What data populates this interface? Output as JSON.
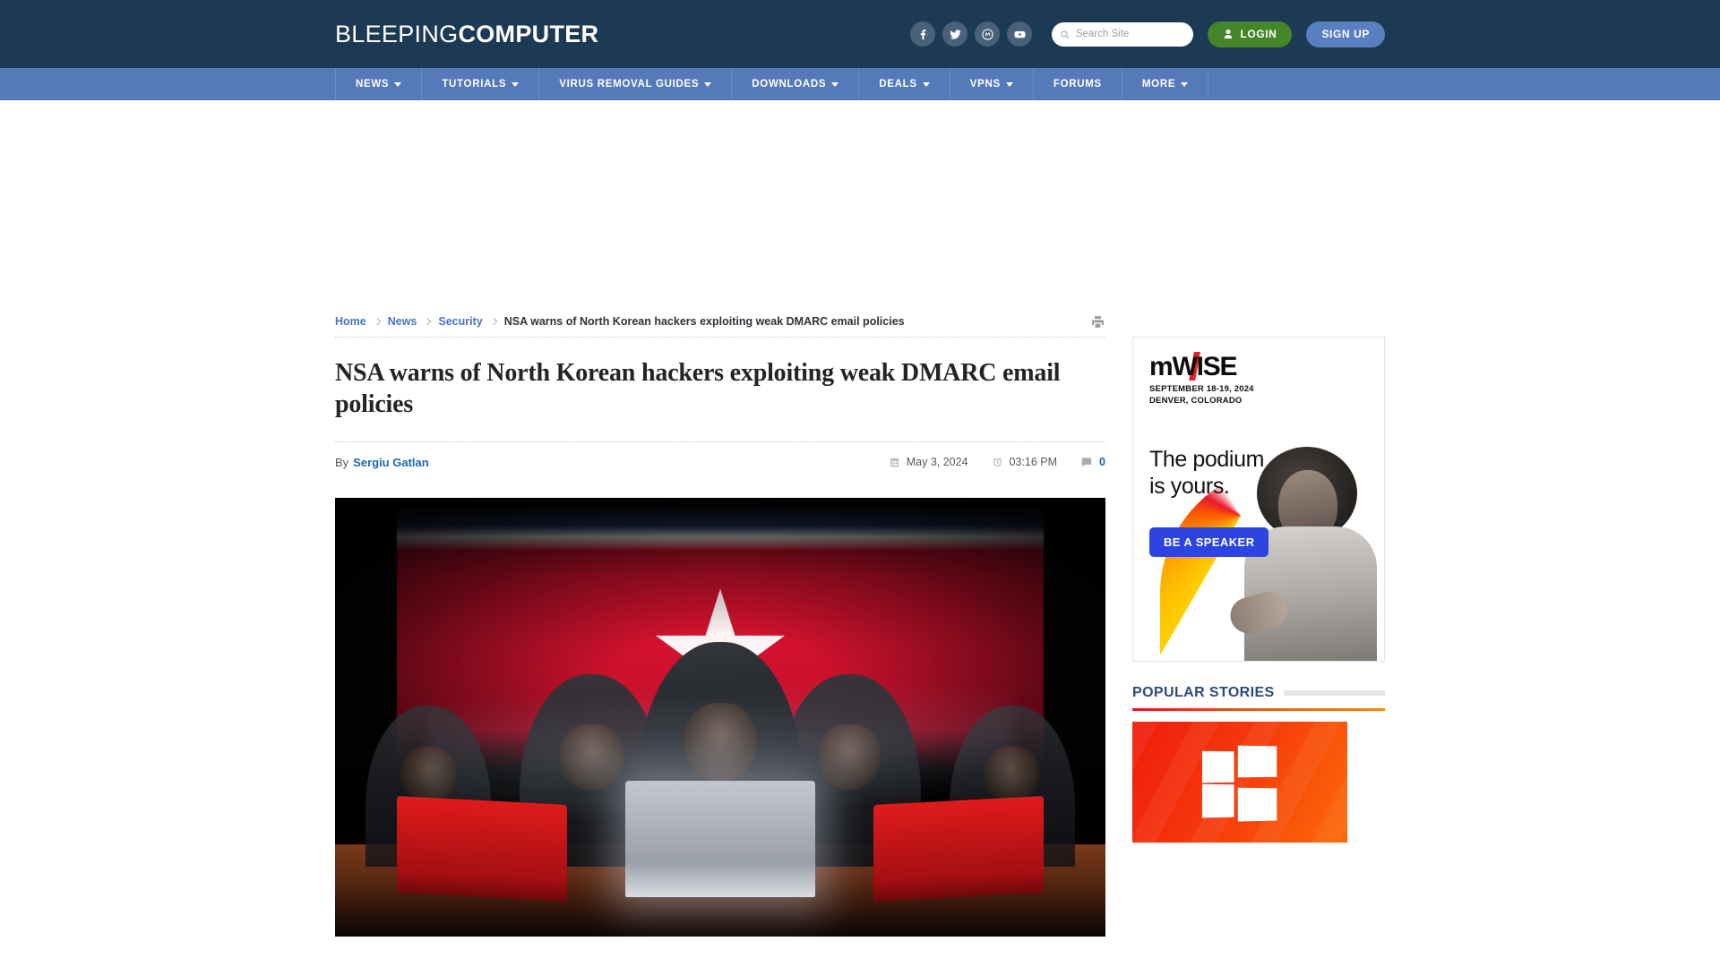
{
  "header": {
    "logo_light": "BLEEPING",
    "logo_bold": "COMPUTER",
    "social": [
      {
        "name": "facebook-icon",
        "label": "Facebook"
      },
      {
        "name": "twitter-icon",
        "label": "Twitter"
      },
      {
        "name": "mastodon-icon",
        "label": "Mastodon"
      },
      {
        "name": "youtube-icon",
        "label": "YouTube"
      }
    ],
    "search_placeholder": "Search Site",
    "search_value": "",
    "login_label": "LOGIN",
    "signup_label": "SIGN UP",
    "bg_color": "#1d3a55",
    "login_color": "#46862a",
    "signup_color": "#5a7fc0"
  },
  "nav": {
    "bg_color": "#5579b9",
    "items": [
      {
        "label": "NEWS",
        "has_dropdown": true
      },
      {
        "label": "TUTORIALS",
        "has_dropdown": true
      },
      {
        "label": "VIRUS REMOVAL GUIDES",
        "has_dropdown": true
      },
      {
        "label": "DOWNLOADS",
        "has_dropdown": true
      },
      {
        "label": "DEALS",
        "has_dropdown": true
      },
      {
        "label": "VPNS",
        "has_dropdown": true
      },
      {
        "label": "FORUMS",
        "has_dropdown": false
      },
      {
        "label": "MORE",
        "has_dropdown": true
      }
    ]
  },
  "breadcrumb": {
    "home": "Home",
    "news": "News",
    "security": "Security",
    "current": "NSA warns of North Korean hackers exploiting weak DMARC email policies"
  },
  "article": {
    "title": "NSA warns of North Korean hackers exploiting weak DMARC email policies",
    "by_label": "By",
    "author": "Sergiu Gatlan",
    "date": "May 3, 2024",
    "time": "03:16 PM",
    "comment_count": "0",
    "hero_alt": "Hooded hackers at laptops in front of a North Korean flag"
  },
  "sidebar": {
    "ad": {
      "brand": "mWISE",
      "dates": "SEPTEMBER 18-19, 2024",
      "location": "DENVER, COLORADO",
      "headline_line1": "The podium",
      "headline_line2": "is yours.",
      "cta": "BE A SPEAKER",
      "cta_color": "#2d44e0",
      "accent_color": "#d8232a"
    },
    "popular": {
      "title": "POPULAR STORIES",
      "thumb_alt": "Windows logo on red orange gradient",
      "accent_color": "#2b4a7e"
    }
  }
}
